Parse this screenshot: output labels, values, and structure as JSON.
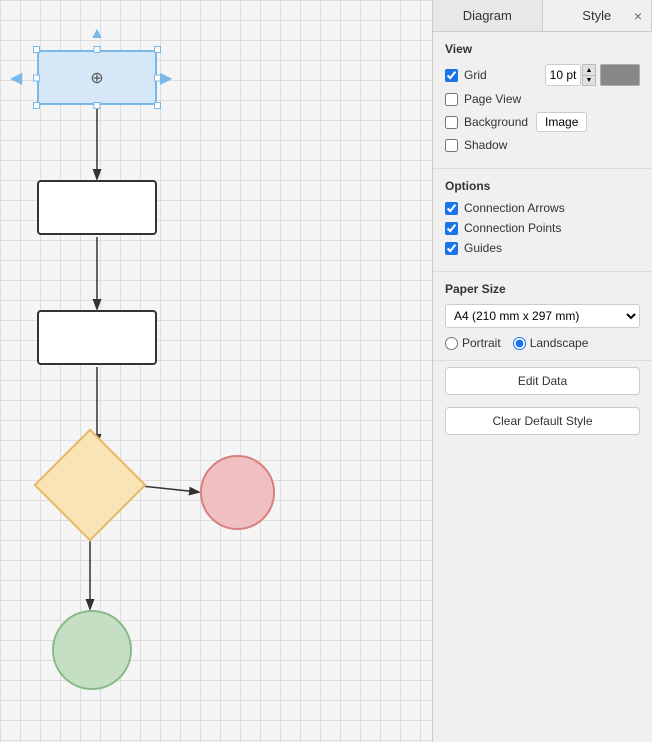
{
  "tabs": {
    "diagram_label": "Diagram",
    "style_label": "Style",
    "close_icon": "×"
  },
  "panel": {
    "view_section": {
      "title": "View",
      "grid_label": "Grid",
      "grid_value": "10 pt",
      "page_view_label": "Page View",
      "background_label": "Background",
      "image_btn_label": "Image",
      "shadow_label": "Shadow"
    },
    "options_section": {
      "title": "Options",
      "connection_arrows_label": "Connection Arrows",
      "connection_points_label": "Connection Points",
      "guides_label": "Guides"
    },
    "paper_size_section": {
      "title": "Paper Size",
      "paper_option": "A4 (210 mm x 297 mm)",
      "portrait_label": "Portrait",
      "landscape_label": "Landscape"
    },
    "edit_data_btn": "Edit Data",
    "clear_default_style_btn": "Clear Default Style"
  },
  "canvas": {
    "move_cursor": "⊕"
  }
}
